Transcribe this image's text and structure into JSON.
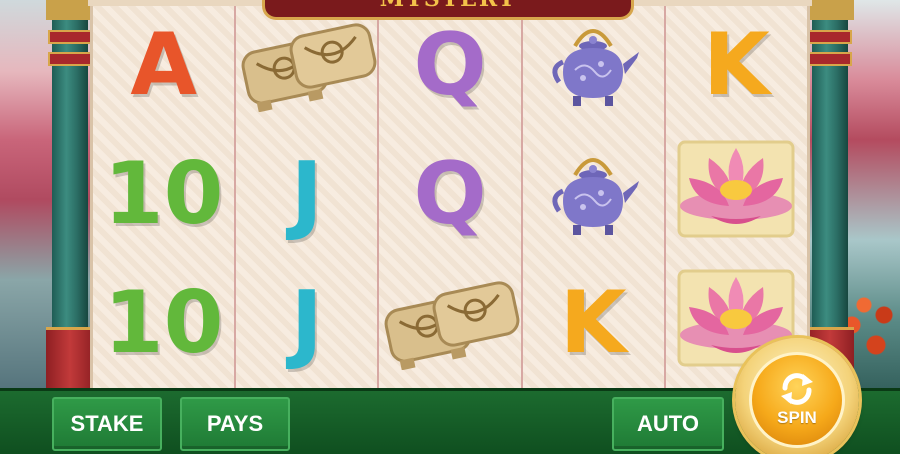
{
  "game": {
    "title": "MYSTERY"
  },
  "reels": [
    {
      "symbols": [
        {
          "type": "letter",
          "text": "A",
          "color": "#e8552a"
        },
        {
          "type": "letter",
          "text": "10",
          "color": "#62b83b"
        },
        {
          "type": "letter",
          "text": "10",
          "color": "#62b83b"
        }
      ]
    },
    {
      "symbols": [
        {
          "type": "icon",
          "icon": "geta-sandals-icon"
        },
        {
          "type": "letter",
          "text": "J",
          "color": "#2cb7cc"
        },
        {
          "type": "letter",
          "text": "J",
          "color": "#2cb7cc"
        }
      ]
    },
    {
      "symbols": [
        {
          "type": "letter",
          "text": "Q",
          "color": "#a46bc9"
        },
        {
          "type": "letter",
          "text": "Q",
          "color": "#a46bc9"
        },
        {
          "type": "icon",
          "icon": "geta-sandals-icon"
        }
      ]
    },
    {
      "symbols": [
        {
          "type": "icon",
          "icon": "teapot-icon"
        },
        {
          "type": "icon",
          "icon": "teapot-icon"
        },
        {
          "type": "letter",
          "text": "K",
          "color": "#f5a91e"
        }
      ]
    },
    {
      "symbols": [
        {
          "type": "letter",
          "text": "K",
          "color": "#f5a91e"
        },
        {
          "type": "icon",
          "icon": "lotus-icon"
        },
        {
          "type": "icon",
          "icon": "lotus-icon"
        }
      ]
    }
  ],
  "controls": {
    "stake_label": "STAKE",
    "pays_label": "PAYS",
    "auto_label": "AUTO",
    "spin_label": "SPIN"
  },
  "colors": {
    "bar_green": "#1c6b2f",
    "button_green": "#2f9a47",
    "spin_orange": "#f6a91a"
  }
}
